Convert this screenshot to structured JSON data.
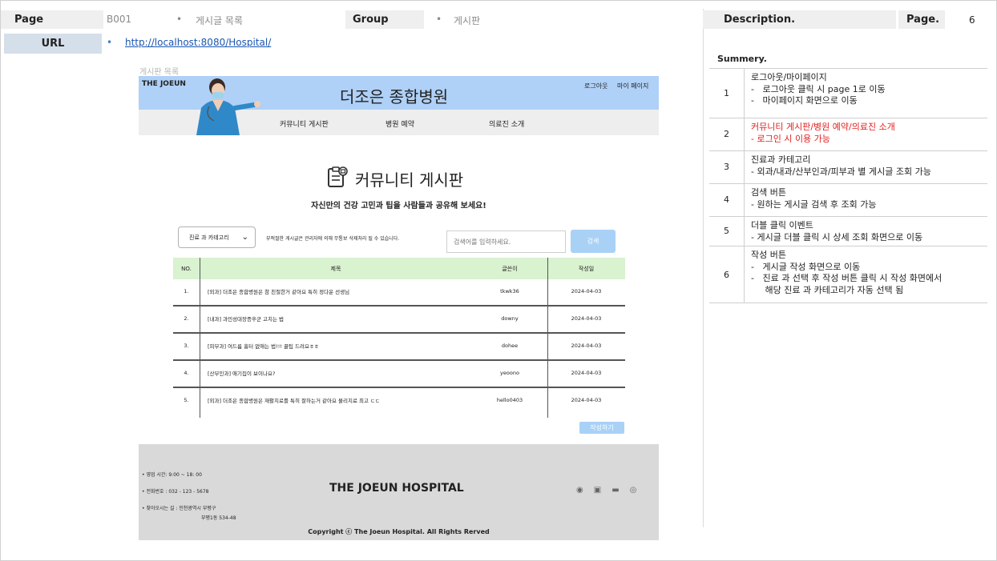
{
  "spec": {
    "page_label": "Page",
    "page_code": "B001",
    "page_name": "게시글 목록",
    "group_label": "Group",
    "group_name": "게시판",
    "url_label": "URL",
    "url": "http://localhost:8080/Hospital/",
    "description_label": "Description.",
    "page_no_label": "Page.",
    "page_no": "6"
  },
  "mock": {
    "caption": "게시판 목록",
    "brand": "THE JOEUN",
    "hospital_name": "더조은 종합병원",
    "top_links": [
      "로그아웃",
      "마이 페이지"
    ],
    "nav": [
      "커뮤니티 게시판",
      "병원 예약",
      "의료진 소개"
    ],
    "board_title": "커뮤니티 게시판",
    "board_subtitle": "자신만의 건강 고민과 팁을 사람들과 공유해 보세요!",
    "category_select": "진료 과 카테고리",
    "notice": "부적절한 게시글은 관리자에 의해 무통보 삭제처리 될 수 있습니다.",
    "search_placeholder": "검색어를 입력하세요.",
    "search_button": "검색",
    "table": {
      "headers": [
        "NO.",
        "제목",
        "글쓴이",
        "작성일"
      ],
      "rows": [
        {
          "no": "1.",
          "title": "[외과] 더조은 종합병원은 참 친절한거 같아요 특히 정다운 선생님",
          "author": "tkwk36",
          "date": "2024-04-03"
        },
        {
          "no": "2.",
          "title": "[내과] 과민성대장증후군 고치는 법",
          "author": "downy",
          "date": "2024-04-03"
        },
        {
          "no": "3.",
          "title": "[피부과] 여드름 흉터 없애는 법!!! 꿀팁 드려요ㅎㅎ",
          "author": "dohee",
          "date": "2024-04-03"
        },
        {
          "no": "4.",
          "title": "[산부인과] 애기집이 보이나요?",
          "author": "yeoono",
          "date": "2024-04-03"
        },
        {
          "no": "5.",
          "title": "[외과] 더조은 종합병원은 재활치료를 특히 잘하는거 같아요 물리치료 최고 ㄷㄷ",
          "author": "hello0403",
          "date": "2024-04-03"
        }
      ]
    },
    "write_button": "작성하기",
    "footer": {
      "hours": "영업 시간: 9:00 ~ 18: 00",
      "phone": "전화번호 : 032 - 123 - 5678",
      "addr1": "찾아오시는 길 : 인천광역시 부평구",
      "addr2": "부평1동 534-48",
      "name": "THE JOEUN HOSPITAL",
      "copyright": "Copyright ⓒ The Joeun Hospital. All Rights Rerved",
      "social_icons": [
        "github-icon",
        "linkedin-icon",
        "youtube-icon",
        "instagram-icon"
      ]
    }
  },
  "summary": {
    "title": "Summery.",
    "items": [
      {
        "no": "1",
        "lines": [
          "로그아웃/마이페이지",
          "-   로그아웃 클릭 시 page 1로 이동",
          "-   마이페이지 화면으로 이동"
        ],
        "color": "#222222"
      },
      {
        "no": "2",
        "lines": [
          "커뮤니티 게시판/병원 예약/의료진 소개",
          "- 로그인 시 이용 가능"
        ],
        "color": "#e02020"
      },
      {
        "no": "3",
        "lines": [
          "진료과 카테고리",
          "- 외과/내과/산부인과/피부과 별 게시글 조회 가능"
        ],
        "color": "#222222"
      },
      {
        "no": "4",
        "lines": [
          "검색 버튼",
          "- 원하는 게시글 검색 후 조회 가능"
        ],
        "color": "#222222"
      },
      {
        "no": "5",
        "lines": [
          "더블 클릭 이벤트",
          "- 게시글 더블 클릭 시 상세 조회 화면으로 이동"
        ],
        "color": "#222222"
      },
      {
        "no": "6",
        "lines": [
          "작성 버튼",
          "-   게시글 작성 화면으로 이동",
          "-   진료 과 선택 후 작성 버튼 클릭 시 작성 화면에서",
          "     해당 진료 과 카테고리가 자동 선택 됨"
        ],
        "color": "#222222"
      }
    ]
  }
}
